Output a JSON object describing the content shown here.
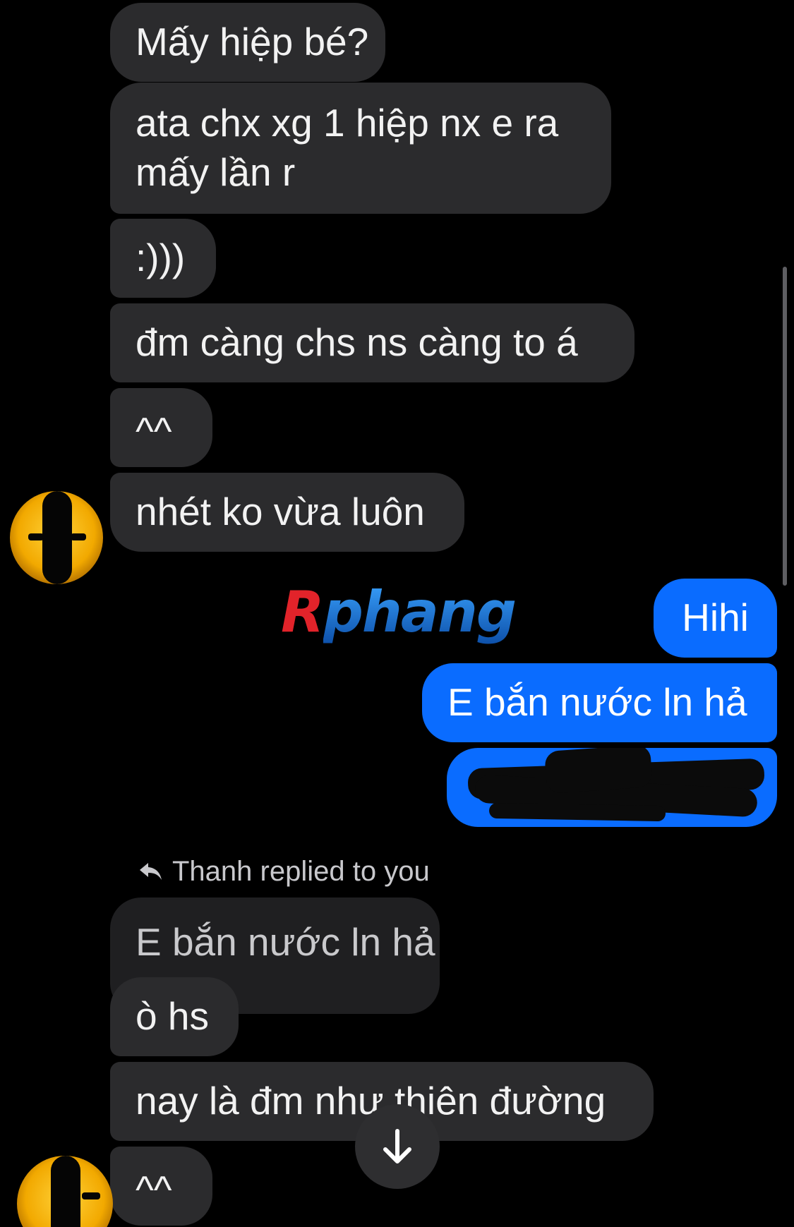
{
  "messages": {
    "m1": "Mấy hiệp bé?",
    "m2_line1": "ata chx xg 1 hiệp nx e ra",
    "m2_line2": "mấy lần r",
    "m3": ":)))",
    "m4": "đm càng chs ns càng to á",
    "m5": "^^",
    "m6": "nhét ko vừa luôn",
    "out1": "Hihi",
    "out2": "E bắn nước ln hả",
    "reply_header": "Thanh replied to you",
    "quoted": "E bắn nước ln hả",
    "m7": "ò hs",
    "m8": "nay là đm như thiên đường",
    "m9": "^^"
  },
  "watermark": {
    "first": "R",
    "rest": "phang"
  },
  "icons": {
    "reply": "reply-arrow-icon",
    "scroll": "arrow-down-icon"
  },
  "colors": {
    "background": "#000000",
    "incoming_bubble": "#2b2b2d",
    "quoted_bubble": "#1f1f21",
    "outgoing_bubble": "#0a6cff"
  }
}
